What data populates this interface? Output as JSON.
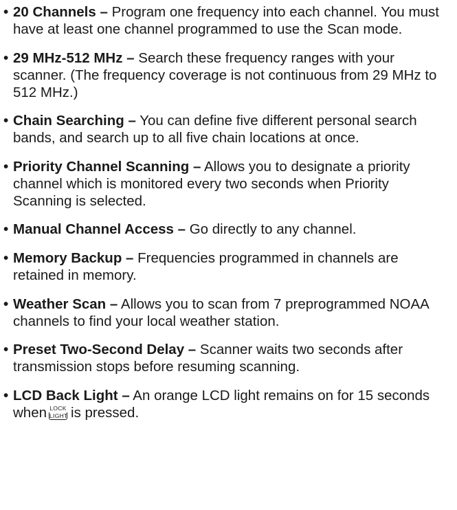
{
  "features": [
    {
      "bullet": "•",
      "term": "20 Channels –",
      "description": "Program one frequency into each channel. You must have at least one channel programmed to use the Scan mode."
    },
    {
      "bullet": "•",
      "term": "29 MHz-512 MHz –",
      "description": "Search these frequency ranges with your scanner. (The frequency coverage is not continuous from 29 MHz to 512 MHz.)"
    },
    {
      "bullet": "•",
      "term": "Chain Searching –",
      "description": "You can define five different personal search bands, and search up to all five chain locations at once."
    },
    {
      "bullet": "•",
      "term": "Priority Channel Scanning –",
      "description": "Allows you to designate a priority channel which is monitored every two seconds when Priority Scanning is selected."
    },
    {
      "bullet": "•",
      "term": "Manual Channel Access –",
      "description": "Go directly to any channel."
    },
    {
      "bullet": "•",
      "term": "Memory Backup –",
      "description": "Frequencies programmed in channels are retained in memory."
    },
    {
      "bullet": "•",
      "term": "Weather Scan –",
      "description": "Allows you to scan from 7 preprogrammed NOAA channels to find your local weather station."
    },
    {
      "bullet": "•",
      "term": "Preset Two-Second Delay –",
      "description": "Scanner waits two seconds after transmission stops before resuming scanning."
    },
    {
      "bullet": "•",
      "term": "LCD Back Light –",
      "description_before": "An orange LCD light remains on for 15 seconds when",
      "key_top": "LOCK",
      "key_bottom": "LIGHT",
      "description_after": "is pressed."
    }
  ]
}
